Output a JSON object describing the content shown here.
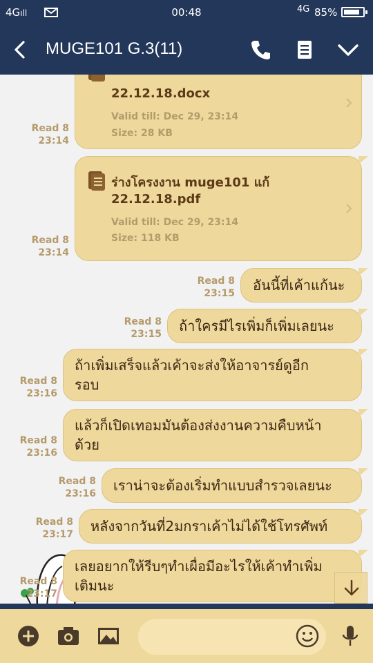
{
  "status_bar": {
    "network_left": "4G",
    "time": "00:48",
    "network_right": "4G",
    "battery_pct": "85%",
    "battery_level": 0.85
  },
  "header": {
    "title": "MUGE101 G.3(11)",
    "icons": [
      "back-arrow-icon",
      "phone-icon",
      "notes-icon",
      "chevron-down-icon"
    ]
  },
  "messages": [
    {
      "type": "file",
      "name_line1": "",
      "name_line2": "22.12.18.docx",
      "valid": "Valid till: Dec 29, 23:14",
      "size": "Size: 28 KB",
      "read": "Read 8",
      "time": "23:14"
    },
    {
      "type": "file",
      "name_line1": "ร่างโครงงาน muge101 แก้",
      "name_line2": "22.12.18.pdf",
      "valid": "Valid till: Dec 29, 23:14",
      "size": "Size: 118 KB",
      "read": "Read 8",
      "time": "23:14"
    },
    {
      "type": "text",
      "lines": [
        "อันนี้ที่เค้าแก้นะ"
      ],
      "read": "Read 8",
      "time": "23:15"
    },
    {
      "type": "text",
      "lines": [
        "ถ้าใครมีไรเพิ่มก็เพิ่มเลยนะ"
      ],
      "read": "Read 8",
      "time": "23:15"
    },
    {
      "type": "text",
      "lines": [
        "ถ้าเพิ่มเสร็จแล้วเค้าจะส่งให้อาจารย์ดูอีก",
        "รอบ"
      ],
      "read": "Read 8",
      "time": "23:16"
    },
    {
      "type": "text",
      "lines": [
        "แล้วก็เปิดเทอมมันต้องส่งงานความคืบหน้า",
        "ด้วย"
      ],
      "read": "Read 8",
      "time": "23:16"
    },
    {
      "type": "text",
      "lines": [
        "เราน่าจะต้องเริ่มทำแบบสำรวจเลยนะ"
      ],
      "read": "Read 8",
      "time": "23:16"
    },
    {
      "type": "text",
      "lines": [
        "หลังจากวันที่2มกราเค้าไม่ได้ใช้โทรศัพท์"
      ],
      "read": "Read 8",
      "time": "23:17"
    },
    {
      "type": "text",
      "lines": [
        "เลยอยากให้รีบๆทำเผื่อมีอะไรให้เค้าทำเพิ่ม",
        "เติมนะ"
      ],
      "read": "Read 8",
      "time": "23:17"
    }
  ],
  "input_bar": {
    "icons": [
      "plus-icon",
      "camera-icon",
      "image-icon",
      "emoji-icon",
      "microphone-icon"
    ]
  },
  "colors": {
    "header": "#23375a",
    "bubble": "#efd89c",
    "bubble_text": "#3a2612",
    "read_meta": "#b59a6b",
    "background": "#f2f2f2"
  }
}
